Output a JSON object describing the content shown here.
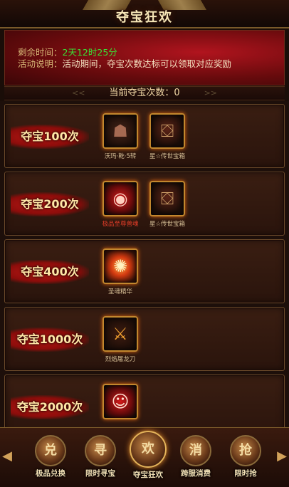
{
  "header": {
    "title": "夺宝狂欢"
  },
  "banner": {
    "time_label": "剩余时间：",
    "time_value": "2天12时25分",
    "desc_label": "活动说明：",
    "desc_value": "活动期间，夺宝次数达标可以领取对应奖励"
  },
  "count_bar": {
    "text": "当前夺宝次数：0"
  },
  "tiers": [
    {
      "label": "夺宝100次",
      "items": [
        {
          "name": "沃玛·乾·5转",
          "icon": "demon-helmet-icon",
          "name_color": "normal"
        },
        {
          "name": "星☆传世宝箱",
          "icon": "dragon-treasure-chest-icon",
          "name_color": "normal"
        }
      ]
    },
    {
      "label": "夺宝200次",
      "items": [
        {
          "name": "极品至尊兽魂",
          "icon": "red-beast-soul-icon",
          "name_color": "red"
        },
        {
          "name": "星☆传世宝箱",
          "icon": "dragon-treasure-chest-icon",
          "name_color": "normal"
        }
      ]
    },
    {
      "label": "夺宝400次",
      "items": [
        {
          "name": "圣魂精华",
          "icon": "holy-soul-essence-icon",
          "name_color": "normal"
        }
      ]
    },
    {
      "label": "夺宝1000次",
      "items": [
        {
          "name": "烈焰屠龙刀",
          "icon": "flame-dragon-blade-icon",
          "name_color": "normal"
        }
      ]
    },
    {
      "label": "夺宝2000次",
      "items": [
        {
          "name": "",
          "icon": "warrior-portrait-icon",
          "name_color": "normal"
        }
      ]
    }
  ],
  "bottom_nav": {
    "tabs": [
      {
        "label": "极品兑换",
        "icon": "exchange-scroll-icon",
        "glyph": "兑",
        "active": false
      },
      {
        "label": "限时寻宝",
        "icon": "treasure-chest-icon",
        "glyph": "寻",
        "active": false
      },
      {
        "label": "夺宝狂欢",
        "icon": "carnival-scroll-icon",
        "glyph": "欢",
        "active": true
      },
      {
        "label": "跨服消费",
        "icon": "gift-box-icon",
        "glyph": "消",
        "active": false
      },
      {
        "label": "限时抢",
        "icon": "gold-coins-icon",
        "glyph": "抢",
        "active": false
      }
    ]
  },
  "colors": {
    "accent_gold": "#c2872e",
    "time_green": "#39e035",
    "rare_red": "#e33d28"
  }
}
